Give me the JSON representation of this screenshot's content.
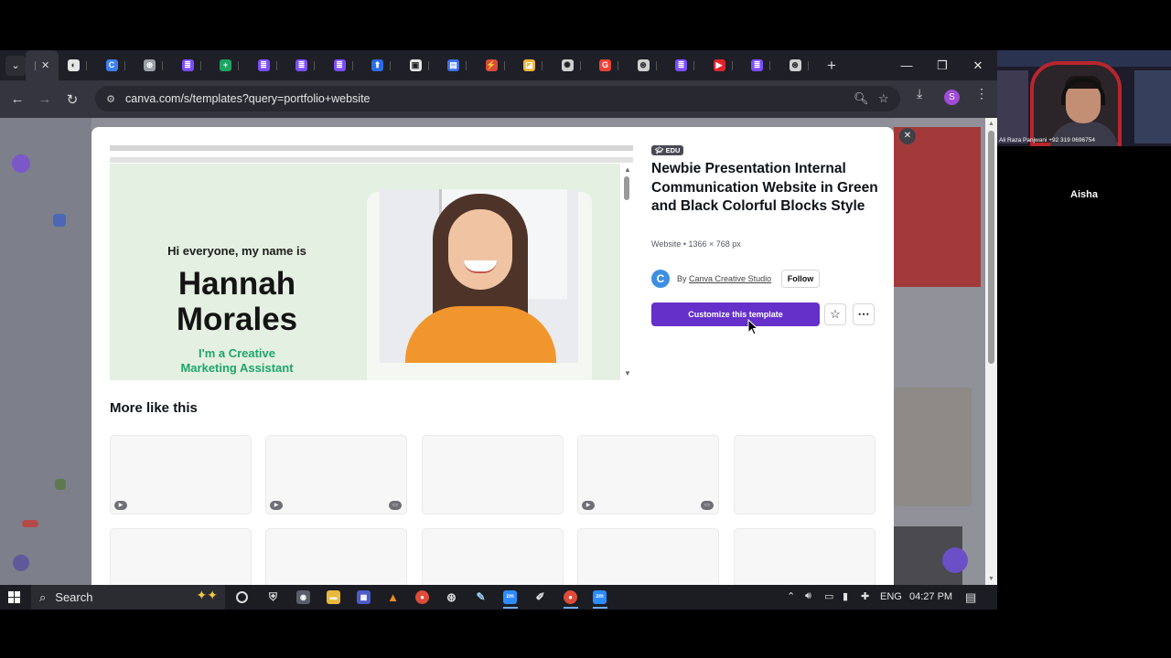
{
  "browser": {
    "tabs": [
      {
        "color": "#e5e5e5",
        "glyph": "◐"
      },
      {
        "color": "#3d7ef0",
        "glyph": "C"
      },
      {
        "color": "#9aa0a6",
        "glyph": "⊛"
      },
      {
        "color": "#7c4dff",
        "glyph": "≣"
      },
      {
        "color": "#1ea362",
        "glyph": "+"
      },
      {
        "color": "#7c4dff",
        "glyph": "≣"
      },
      {
        "color": "#7c4dff",
        "glyph": "≣"
      },
      {
        "color": "#7c4dff",
        "glyph": "≣"
      },
      {
        "color": "#2b6ce6",
        "glyph": "⬆"
      },
      {
        "color": "#e5e5e5",
        "glyph": "▣"
      },
      {
        "color": "#3d6de6",
        "glyph": "▤"
      },
      {
        "color": "#d84a3c",
        "glyph": "⚡"
      },
      {
        "color": "#f0b43c",
        "glyph": "◪"
      },
      {
        "color": "#cfcfcf",
        "glyph": "✺"
      },
      {
        "color": "#ea4335",
        "glyph": "G"
      },
      {
        "color": "#cfcfcf",
        "glyph": "⊛"
      },
      {
        "color": "#7c4dff",
        "glyph": "≣"
      },
      {
        "color": "#e0242c",
        "glyph": "▶"
      },
      {
        "color": "#7c4dff",
        "glyph": "≣"
      },
      {
        "color": "#cfcfcf",
        "glyph": "⊛"
      }
    ],
    "url": "canva.com/s/templates?query=portfolio+website",
    "profile_initial": "S"
  },
  "modal": {
    "preview": {
      "greeting": "Hi everyone, my name is",
      "name_line1": "Hannah",
      "name_line2": "Morales",
      "role_line1": "I'm a Creative",
      "role_line2": "Marketing Assistant"
    },
    "badge": "EDU",
    "title": "Newbie Presentation Internal Communication Website in Green and Black Colorful Blocks Style",
    "meta": "Website • 1366 × 768 px",
    "creator_prefix": "By",
    "creator_name": "Canva Creative Studio",
    "follow_label": "Follow",
    "customize_label": "Customize this template",
    "more_title": "More like this",
    "cards": [
      {
        "badge": "video-icon"
      },
      {
        "badge": "video-icon"
      },
      {
        "badge": ""
      },
      {
        "badge": "video-icon"
      },
      {
        "badge": ""
      },
      {
        "badge": ""
      },
      {
        "badge": ""
      },
      {
        "badge": ""
      },
      {
        "badge": ""
      },
      {
        "badge": ""
      }
    ]
  },
  "taskbar": {
    "search_label": "Search",
    "language": "ENG",
    "time": "04:27 PM"
  },
  "video": {
    "caption": "Ali Raza Panjwani +92 319 0696754",
    "participant": "Aisha"
  }
}
